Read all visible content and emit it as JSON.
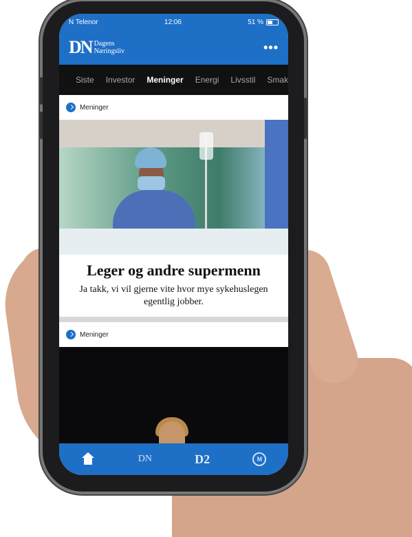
{
  "status": {
    "carrier": "N Telenor",
    "time": "12:06",
    "battery": "51 %"
  },
  "appbar": {
    "logo_mark": "DN",
    "logo_line1": "Dagens",
    "logo_line2": "Næringsliv",
    "more": "•••"
  },
  "tabs": [
    "Siste",
    "Investor",
    "Meninger",
    "Energi",
    "Livsstil",
    "Smak"
  ],
  "active_tab": "Meninger",
  "articles": [
    {
      "tag": "Meninger",
      "title": "Leger og andre supermenn",
      "subtitle": "Ja takk, vi vil gjerne vite hvor mye sykehuslegen egentlig jobber."
    },
    {
      "tag": "Meninger"
    }
  ],
  "bottom_nav": {
    "dn": "DN",
    "d2": "D2",
    "m": "M"
  },
  "colors": {
    "brand_blue": "#1e6fc6",
    "tab_bar": "#111111"
  }
}
